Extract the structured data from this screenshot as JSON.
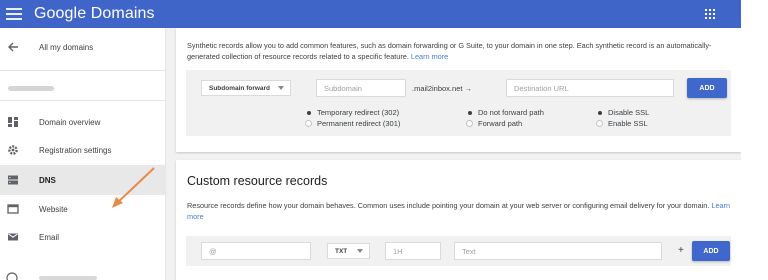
{
  "appbar": {
    "brand": "Google Domains",
    "accent": "#4065c9"
  },
  "sidebar": {
    "back_label": "All my domains",
    "items": [
      {
        "label": "Domain overview",
        "icon": "dashboard-icon"
      },
      {
        "label": "Registration settings",
        "icon": "gear-icon"
      },
      {
        "label": "DNS",
        "icon": "dns-icon",
        "active": true
      },
      {
        "label": "Website",
        "icon": "website-icon"
      },
      {
        "label": "Email",
        "icon": "email-icon"
      }
    ]
  },
  "synthetic": {
    "description": "Synthetic records allow you to add common features, such as domain forwarding or G Suite, to your domain in one step. Each synthetic record is an automatically-generated collection of resource records related to a specific feature.",
    "learn_more": "Learn more",
    "record_type": "Subdomain forward",
    "subdomain_placeholder": "Subdomain",
    "domain_suffix": ".mail2inbox.net →",
    "destination_placeholder": "Destination URL",
    "add_label": "ADD",
    "options": {
      "redirect": [
        {
          "label": "Temporary redirect (302)",
          "selected": true
        },
        {
          "label": "Permanent redirect (301)",
          "selected": false
        }
      ],
      "path": [
        {
          "label": "Do not forward path",
          "selected": true
        },
        {
          "label": "Forward path",
          "selected": false
        }
      ],
      "ssl": [
        {
          "label": "Disable SSL",
          "selected": true
        },
        {
          "label": "Enable SSL",
          "selected": false
        }
      ]
    }
  },
  "custom": {
    "title": "Custom resource records",
    "description": "Resource records define how your domain behaves. Common uses include pointing your domain at your web server or configuring email delivery for your domain.",
    "learn_more": "Learn more",
    "name_placeholder": "@",
    "type_value": "TXT",
    "ttl_placeholder": "1H",
    "data_placeholder": "Text",
    "plus": "+",
    "add_label": "ADD"
  }
}
